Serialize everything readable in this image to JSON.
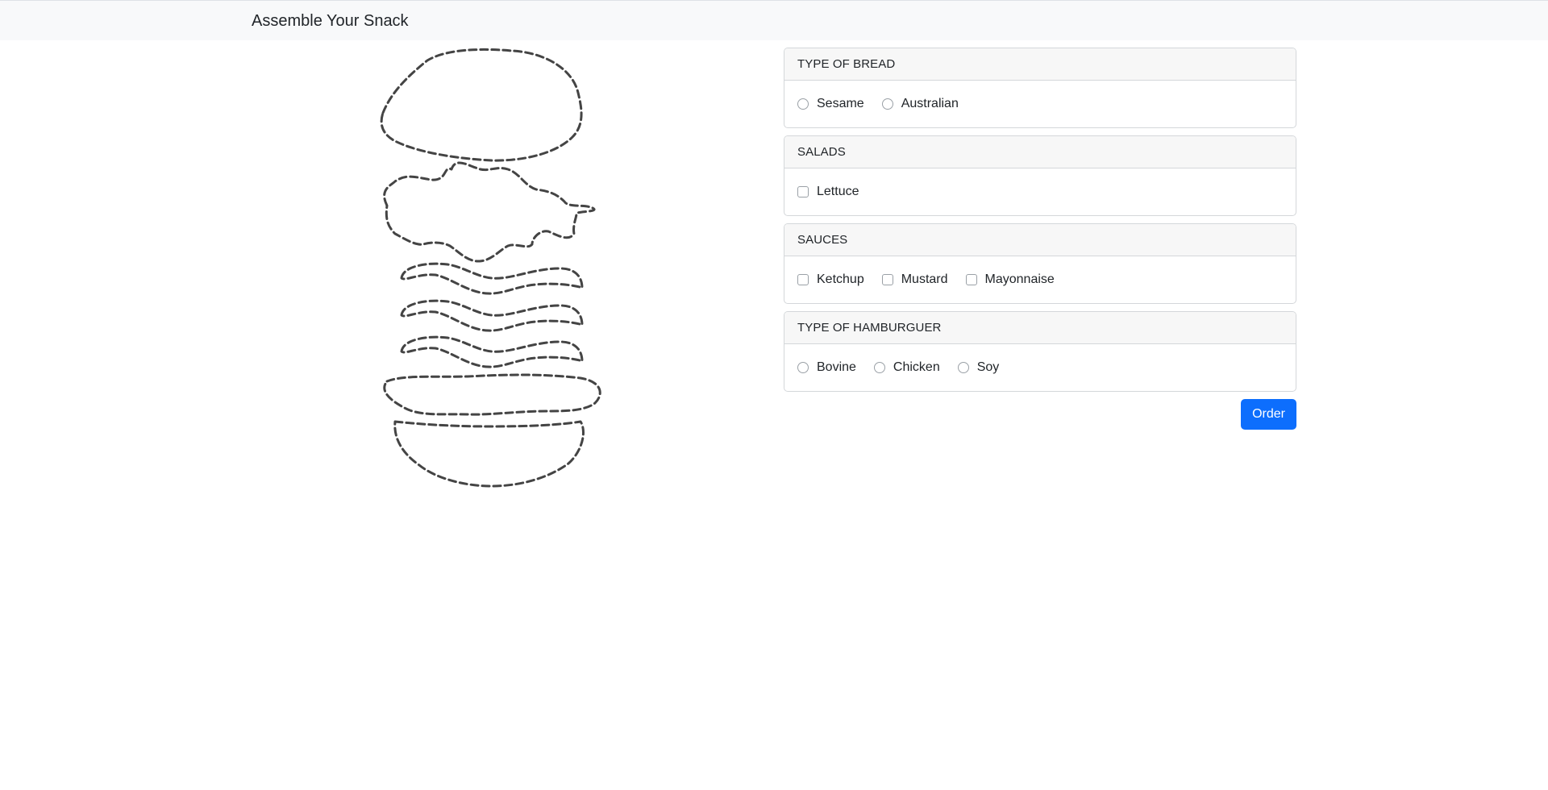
{
  "navbar": {
    "title": "Assemble Your Snack"
  },
  "illustration": {
    "layers": [
      "top-bun",
      "lettuce",
      "bacon-strip",
      "bacon-strip",
      "bacon-strip",
      "patty",
      "bottom-bun"
    ],
    "stroke_color": "#444444"
  },
  "sections": {
    "bread": {
      "header": "TYPE OF BREAD",
      "control": "radio",
      "options": [
        "Sesame",
        "Australian"
      ]
    },
    "salads": {
      "header": "SALADS",
      "control": "checkbox",
      "options": [
        "Lettuce"
      ]
    },
    "sauces": {
      "header": "SAUCES",
      "control": "checkbox",
      "options": [
        "Ketchup",
        "Mustard",
        "Mayonnaise"
      ]
    },
    "hamburger": {
      "header": "TYPE OF HAMBURGUER",
      "control": "radio",
      "options": [
        "Bovine",
        "Chicken",
        "Soy"
      ]
    }
  },
  "order_button": {
    "label": "Order",
    "color": "#0d6efd"
  }
}
